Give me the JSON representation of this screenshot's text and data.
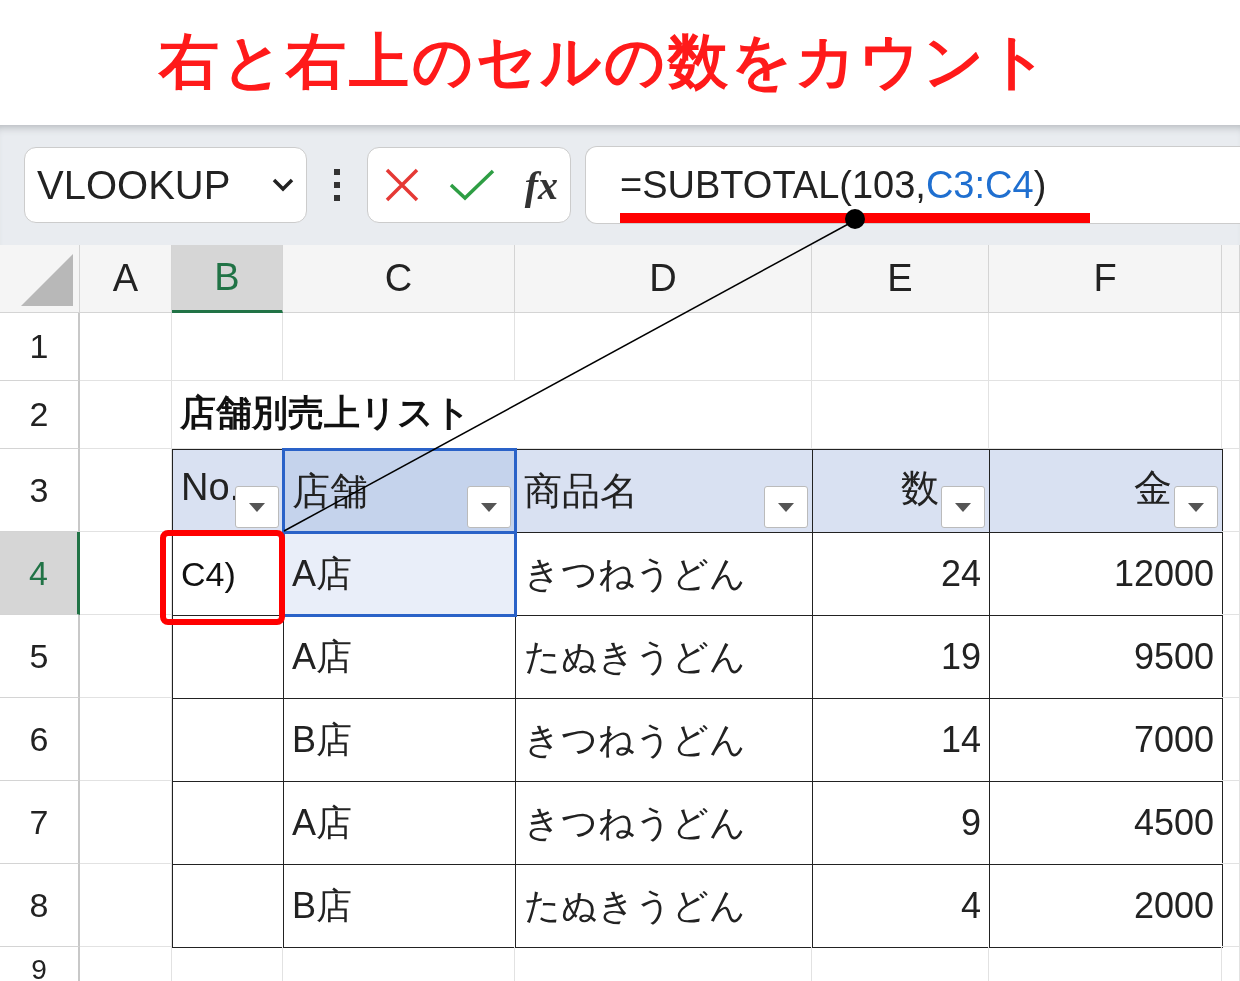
{
  "title": "右と右上のセルの数をカウント",
  "name_box": {
    "value": "VLOOKUP"
  },
  "function_button": "fx",
  "formula": [
    {
      "text": "=SUBTOTAL(103,",
      "kind": "plain"
    },
    {
      "text": "C3:C4",
      "kind": "ref"
    },
    {
      "text": ")",
      "kind": "plain"
    }
  ],
  "columns": [
    {
      "label": "A",
      "selected": false
    },
    {
      "label": "B",
      "selected": true
    },
    {
      "label": "C",
      "selected": false
    },
    {
      "label": "D",
      "selected": false
    },
    {
      "label": "E",
      "selected": false
    },
    {
      "label": "F",
      "selected": false
    }
  ],
  "rows": [
    {
      "label": "1",
      "selected": false
    },
    {
      "label": "2",
      "selected": false
    },
    {
      "label": "3",
      "selected": false
    },
    {
      "label": "4",
      "selected": true
    },
    {
      "label": "5",
      "selected": false
    },
    {
      "label": "6",
      "selected": false
    },
    {
      "label": "7",
      "selected": false
    },
    {
      "label": "8",
      "selected": false
    },
    {
      "label": "9",
      "selected": false
    }
  ],
  "sheet_title": "店舗別売上リスト",
  "table": {
    "headers": [
      {
        "text": "No.",
        "selected": false
      },
      {
        "text": "店舗",
        "selected": true
      },
      {
        "text": "商品名",
        "selected": false
      },
      {
        "text": "数",
        "selected": false
      },
      {
        "text": "金",
        "selected": false
      }
    ],
    "rows": [
      {
        "no": "C4)",
        "shop": "A店",
        "item": "きつねうどん",
        "qty": "24",
        "amount": "12000",
        "selected": true
      },
      {
        "shop": "A店",
        "item": "たぬきうどん",
        "qty": "19",
        "amount": "9500",
        "selected": false
      },
      {
        "shop": "B店",
        "item": "きつねうどん",
        "qty": "14",
        "amount": "7000",
        "selected": false
      },
      {
        "shop": "A店",
        "item": "きつねうどん",
        "qty": "9",
        "amount": "4500",
        "selected": false
      },
      {
        "shop": "B店",
        "item": "たぬきうどん",
        "qty": "4",
        "amount": "2000",
        "selected": false
      }
    ]
  }
}
